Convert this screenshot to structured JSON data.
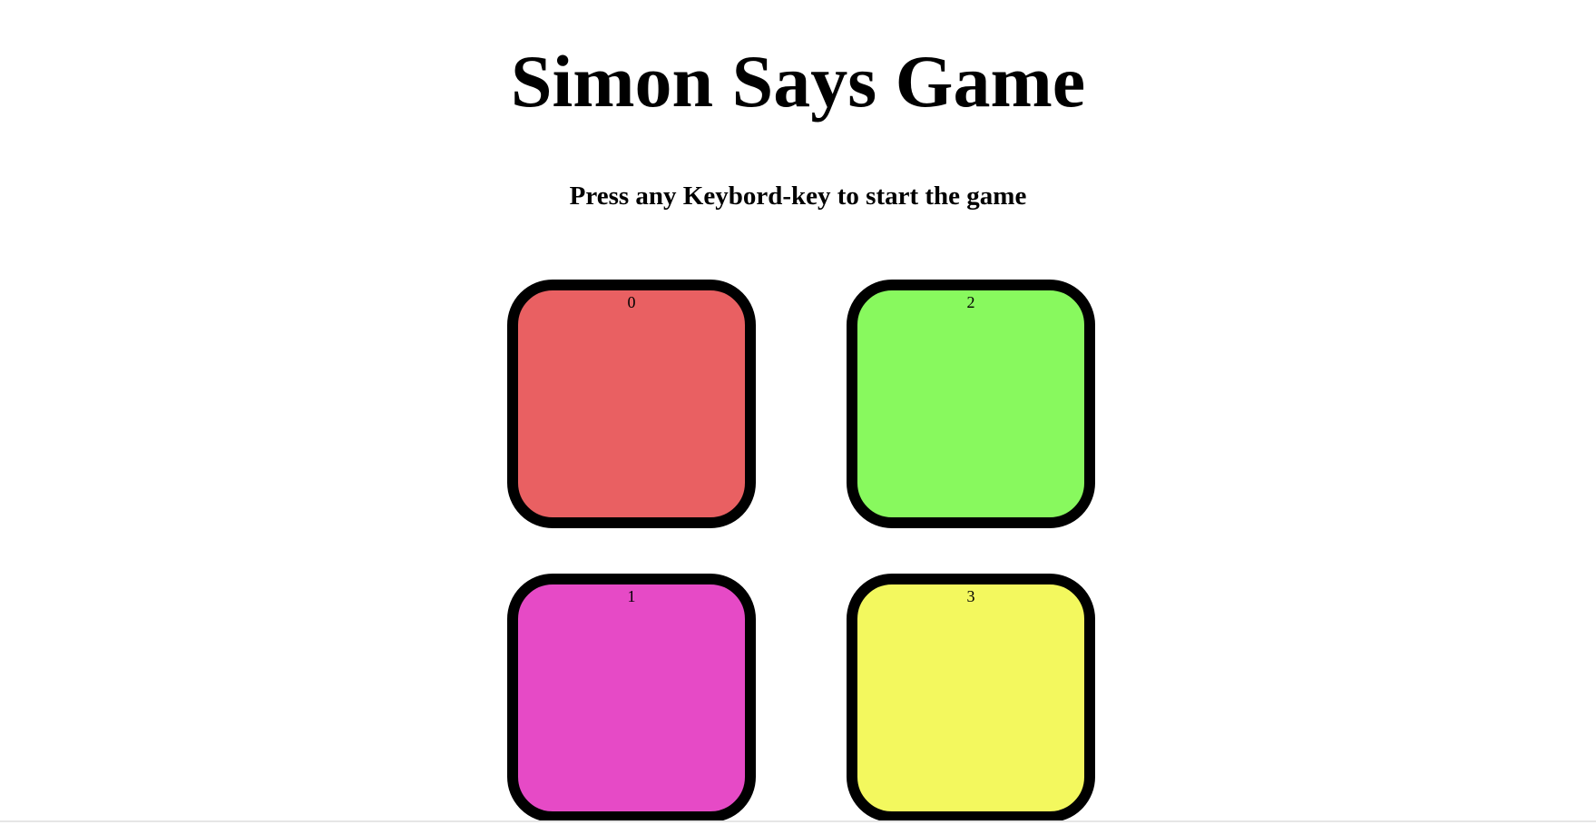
{
  "title": "Simon Says Game",
  "subtitle": "Press any Keybord-key to start the game",
  "buttons": [
    {
      "id": "0",
      "color": "#e96062"
    },
    {
      "id": "1",
      "color": "#e64ac6"
    },
    {
      "id": "2",
      "color": "#88f95e"
    },
    {
      "id": "3",
      "color": "#f3f85e"
    }
  ]
}
